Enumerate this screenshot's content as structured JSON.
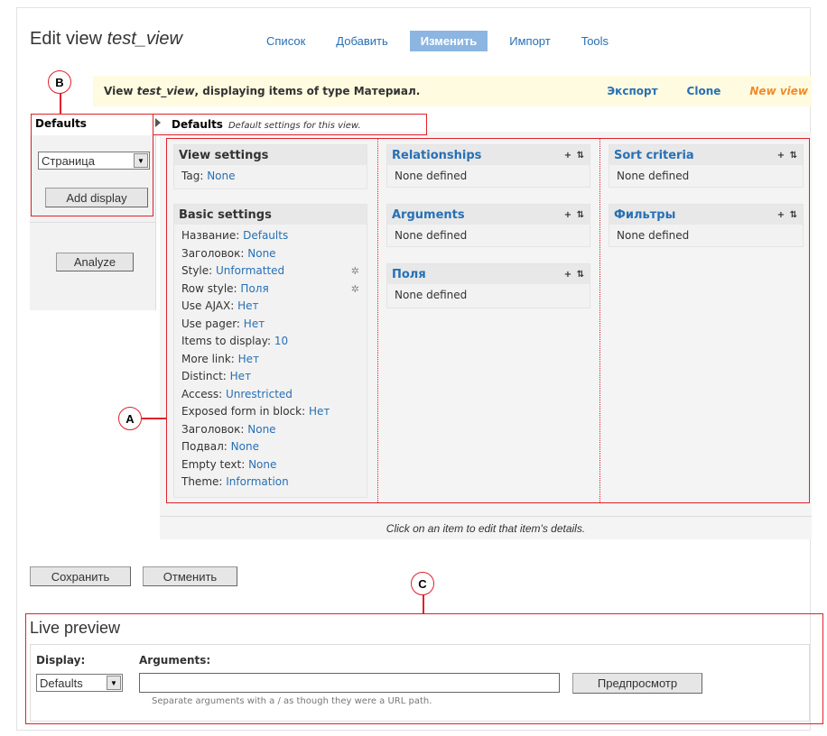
{
  "header": {
    "title_prefix": "Edit view",
    "title_view": "test_view",
    "tabs": [
      {
        "label": "Список",
        "active": false
      },
      {
        "label": "Добавить",
        "active": false
      },
      {
        "label": "Изменить",
        "active": true
      },
      {
        "label": "Импорт",
        "active": false
      },
      {
        "label": "Tools",
        "active": false
      }
    ]
  },
  "infobar": {
    "text_view": "View",
    "view_name": "test_view",
    "text_rest": ", displaying items of type Материал.",
    "links": {
      "export": "Экспорт",
      "clone": "Clone",
      "new_view": "New view"
    }
  },
  "left": {
    "tab": "Defaults",
    "display_select": "Страница",
    "add_display": "Add display",
    "analyze": "Analyze"
  },
  "defaults_header": {
    "title": "Defaults",
    "subtitle": "Default settings for this view."
  },
  "view_settings": {
    "title": "View settings",
    "tag_label": "Tag:",
    "tag_value": "None"
  },
  "basic_settings": {
    "title": "Basic settings",
    "rows": [
      {
        "label": "Название:",
        "value": "Defaults"
      },
      {
        "label": "Заголовок:",
        "value": "None"
      },
      {
        "label": "Style:",
        "value": "Unformatted"
      },
      {
        "label": "Row style:",
        "value": "Поля"
      },
      {
        "label": "Use AJAX:",
        "value": "Нет"
      },
      {
        "label": "Use pager:",
        "value": "Нет"
      },
      {
        "label": "Items to display:",
        "value": "10"
      },
      {
        "label": "More link:",
        "value": "Нет"
      },
      {
        "label": "Distinct:",
        "value": "Нет"
      },
      {
        "label": "Access:",
        "value": "Unrestricted"
      },
      {
        "label": "Exposed form in block:",
        "value": "Нет"
      },
      {
        "label": "Заголовок:",
        "value": "None"
      },
      {
        "label": "Подвал:",
        "value": "None"
      },
      {
        "label": "Empty text:",
        "value": "None"
      },
      {
        "label": "Theme:",
        "value": "Information"
      }
    ]
  },
  "middle": {
    "relationships": {
      "title": "Relationships",
      "empty": "None defined"
    },
    "arguments": {
      "title": "Arguments",
      "empty": "None defined"
    },
    "fields": {
      "title": "Поля",
      "empty": "None defined"
    }
  },
  "right": {
    "sort": {
      "title": "Sort criteria",
      "empty": "None defined"
    },
    "filters": {
      "title": "Фильтры",
      "empty": "None defined"
    }
  },
  "controls": {
    "add": "+",
    "rearrange": "⇅"
  },
  "footer_note": "Click on an item to edit that item's details.",
  "actions": {
    "save": "Сохранить",
    "cancel": "Отменить"
  },
  "live_preview": {
    "title": "Live preview",
    "display_label": "Display:",
    "display_value": "Defaults",
    "arguments_label": "Arguments:",
    "arguments_value": "",
    "preview_button": "Предпросмотр",
    "hint": "Separate arguments with a / as though they were a URL path."
  },
  "annotations": {
    "a": "A",
    "b": "B",
    "c": "C"
  }
}
